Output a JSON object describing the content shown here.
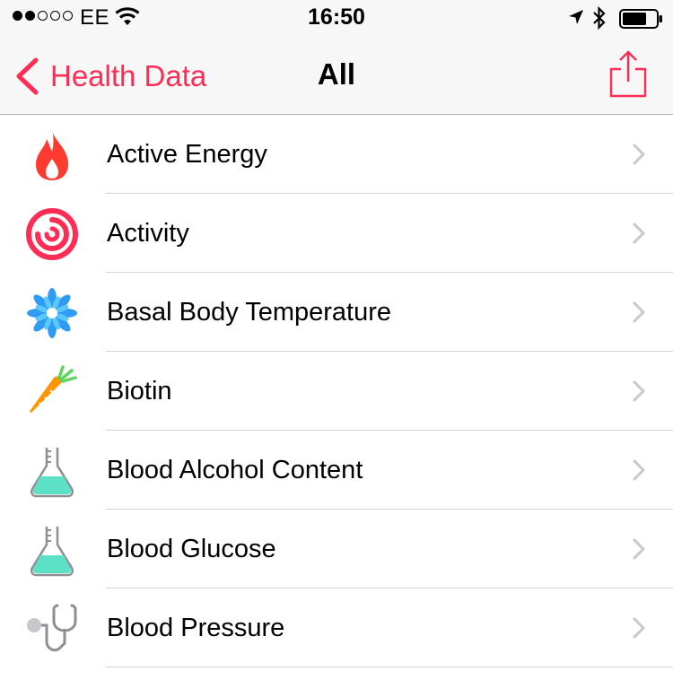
{
  "status_bar": {
    "carrier": "EE",
    "time": "16:50"
  },
  "nav": {
    "back_label": "Health Data",
    "title": "All"
  },
  "colors": {
    "accent": "#ff2d55",
    "flame": "#ff3b30",
    "activity": "#ff2d55",
    "temperature": "#2f9bf2",
    "carrot": "#ff9500",
    "carrot_top": "#5dd55d",
    "flask_liquid": "#5ce1c7",
    "stethoscope": "#8e8e93"
  },
  "items": [
    {
      "label": "Active Energy",
      "icon": "flame-icon"
    },
    {
      "label": "Activity",
      "icon": "activity-rings-icon"
    },
    {
      "label": "Basal Body Temperature",
      "icon": "snowflake-flower-icon"
    },
    {
      "label": "Biotin",
      "icon": "carrot-icon"
    },
    {
      "label": "Blood Alcohol Content",
      "icon": "flask-icon"
    },
    {
      "label": "Blood Glucose",
      "icon": "flask-icon"
    },
    {
      "label": "Blood Pressure",
      "icon": "stethoscope-icon"
    }
  ]
}
